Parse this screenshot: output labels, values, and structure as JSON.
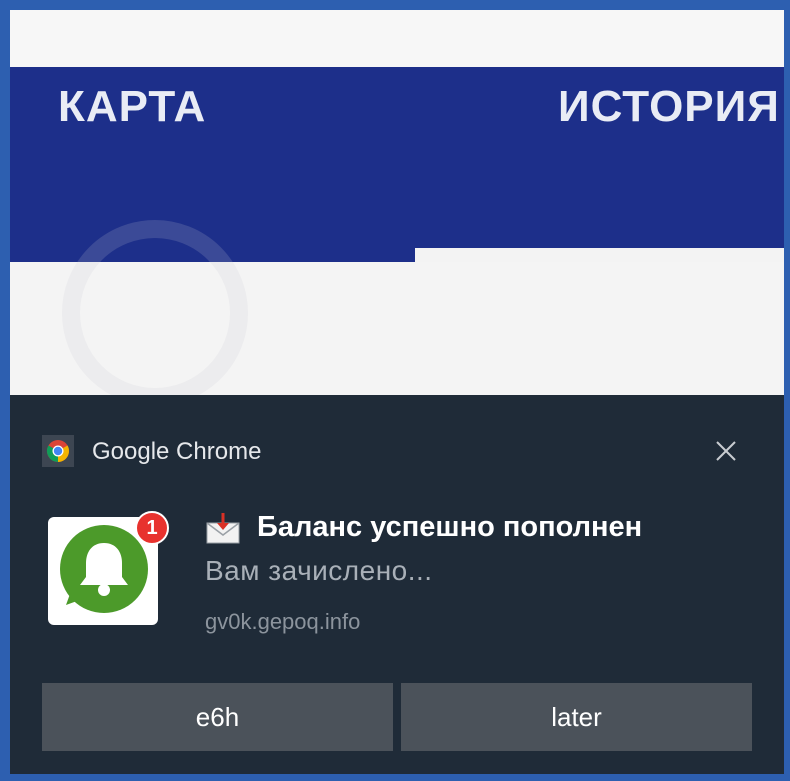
{
  "background_site": {
    "nav_items": [
      "КАРТА",
      "ИСТОРИЯ"
    ],
    "nav_color": "#1d2f8a"
  },
  "notification": {
    "app_name": "Google Chrome",
    "app_icon": "chrome-icon",
    "close_icon": "close-icon",
    "badge_count": "1",
    "title_icon": "envelope-arrow-icon",
    "title": "Баланс успешно пополнен",
    "body": "Вам зачислено...",
    "source": "gv0k.gepoq.info",
    "buttons": [
      {
        "label": "e6h"
      },
      {
        "label": "later"
      }
    ],
    "colors": {
      "background": "#1f2b38",
      "button": "#4b525a",
      "badge": "#e8322e",
      "icon_green": "#4c9a2a"
    }
  }
}
